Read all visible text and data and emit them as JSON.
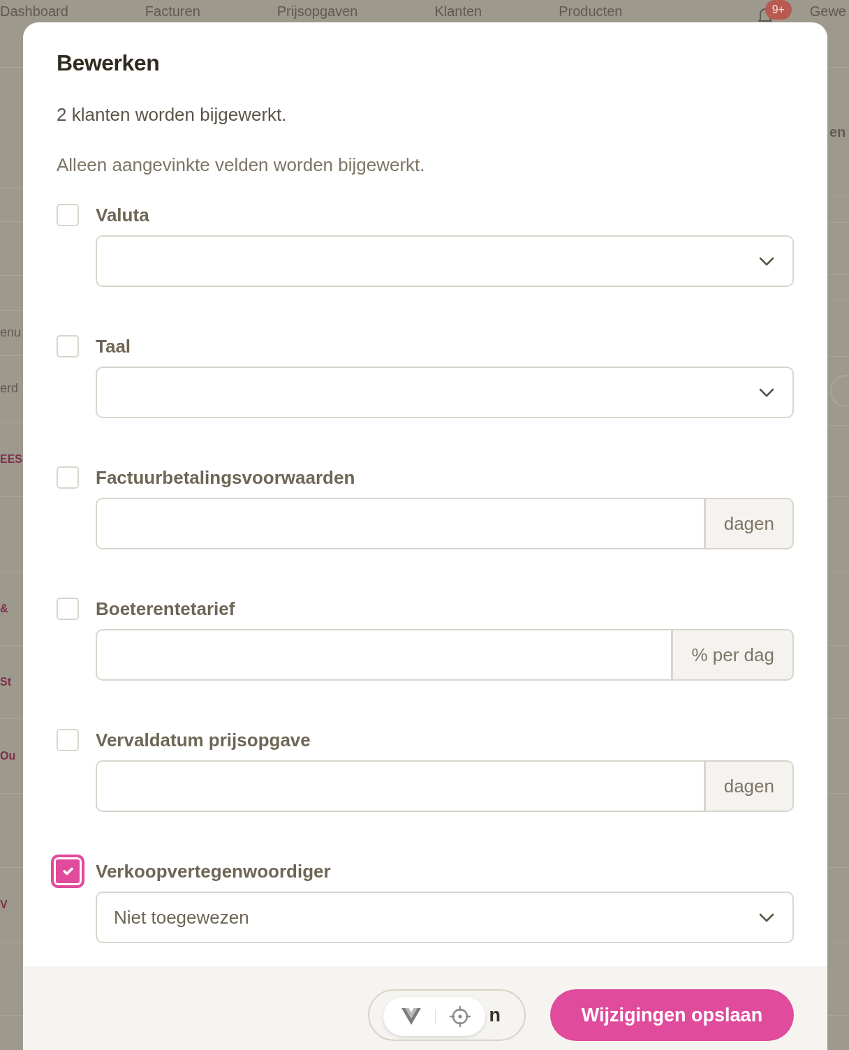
{
  "background_page": {
    "nav": [
      {
        "kind": "link",
        "label": "Dashboard"
      },
      {
        "kind": "link",
        "label": "Facturen"
      },
      {
        "kind": "link",
        "label": "Prijsopgaven"
      },
      {
        "kind": "link",
        "label": "Klanten"
      },
      {
        "kind": "link",
        "label": "Producten"
      },
      {
        "kind": "notifications",
        "badge": "9+"
      },
      {
        "kind": "link",
        "label": "Gewe"
      }
    ],
    "left_column": [
      {
        "kind": "plain",
        "text": "enu"
      },
      {
        "kind": "plain",
        "text": "erd"
      },
      {
        "kind": "link",
        "text": "EES"
      },
      {
        "kind": "link",
        "text": "&"
      },
      {
        "kind": "link",
        "text": "St"
      },
      {
        "kind": "link",
        "text": "Ou"
      },
      {
        "kind": "link",
        "text": "V"
      }
    ],
    "right_column": [
      {
        "text": "en"
      }
    ]
  },
  "modal": {
    "title": "Bewerken",
    "summary": "2 klanten worden bijgewerkt.",
    "hint": "Alleen aangevinkte velden worden bijgewerkt.",
    "fields": [
      {
        "kind": "select",
        "label": "Valuta",
        "checked": false
      },
      {
        "kind": "select",
        "label": "Taal",
        "checked": false
      },
      {
        "kind": "input",
        "label": "Factuurbetalingsvoorwaarden",
        "checked": false,
        "addon": "dagen"
      },
      {
        "kind": "input",
        "label": "Boeterentetarief",
        "checked": false,
        "addon": "% per dag"
      },
      {
        "kind": "input",
        "label": "Vervaldatum prijsopgave",
        "checked": false,
        "addon": "dagen"
      },
      {
        "kind": "select",
        "label": "Verkoopvertegenwoordiger",
        "checked": true,
        "value": "Niet toegewezen"
      }
    ],
    "footer": {
      "cancel_button": "n",
      "save_button": "Wijzigingen opslaan"
    }
  }
}
